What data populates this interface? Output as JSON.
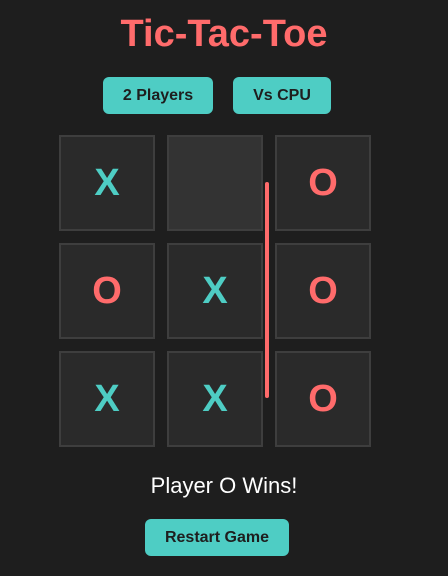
{
  "title": "Tic-Tac-Toe",
  "modes": {
    "two_players": "2 Players",
    "vs_cpu": "Vs CPU"
  },
  "board": {
    "cells": [
      "X",
      "",
      "O",
      "O",
      "X",
      "O",
      "X",
      "X",
      "O"
    ],
    "winning_line": [
      2,
      5,
      8
    ]
  },
  "status": "Player O Wins!",
  "restart_label": "Restart Game",
  "colors": {
    "background": "#1e1e1e",
    "accent": "#4ecdc4",
    "x_mark": "#4ecdc4",
    "o_mark": "#ff6b6b",
    "win_line": "#ff6b6b"
  }
}
